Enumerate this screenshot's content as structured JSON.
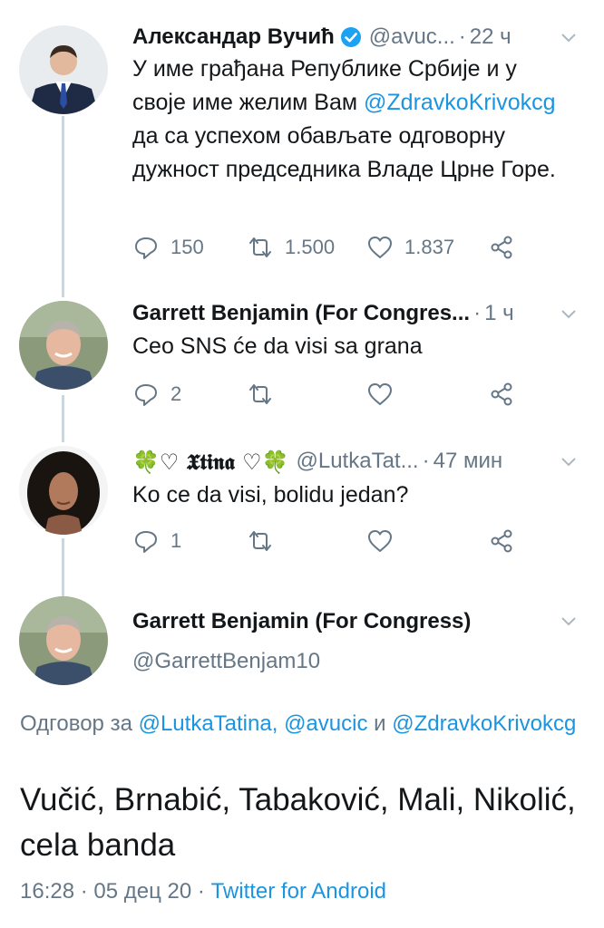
{
  "tweets": [
    {
      "name": "Александар Вучић",
      "handle": "@avuc...",
      "time": "22 ч",
      "verified": true,
      "text_parts": [
        "У име грађана Републике Србије и у своје име желим Вам ",
        "@ZdravkoKrivokcg",
        " да са успехом обављате одговорну дужност председника Владе Црне Горе."
      ],
      "replies": "150",
      "retweets": "1.500",
      "likes": "1.837"
    },
    {
      "name": "Garrett Benjamin (For Congres...",
      "time": "1 ч",
      "text": "Ceo SNS će da visi sa grana",
      "replies": "2",
      "retweets": "",
      "likes": ""
    },
    {
      "name": "🍀♡ 𝖃𝖙𝖎𝖓𝖆 ♡🍀",
      "handle": "@LutkaTat...",
      "time": "47 мин",
      "text": "Ko ce da visi, bolidu jedan?",
      "replies": "1",
      "retweets": "",
      "likes": ""
    }
  ],
  "detail": {
    "name": "Garrett Benjamin (For Congress)",
    "handle": "@GarrettBenjam10",
    "reply_label": "Одговор за",
    "reply_mention_1": "@LutkaTatina,",
    "reply_mention_2": "@avucic",
    "reply_and": "и",
    "reply_mention_3": "@ZdravkoKrivokcg",
    "text": "Vučić, Brnabić, Tabaković, Mali, Nikolić, cela banda",
    "time": "16:28",
    "date": "05 дец 20",
    "source": "Twitter for Android"
  },
  "colors": {
    "accent": "#1b95e0",
    "muted": "#657786",
    "text": "#14171a",
    "thread_line": "#ccd6dd"
  },
  "separator": "·"
}
